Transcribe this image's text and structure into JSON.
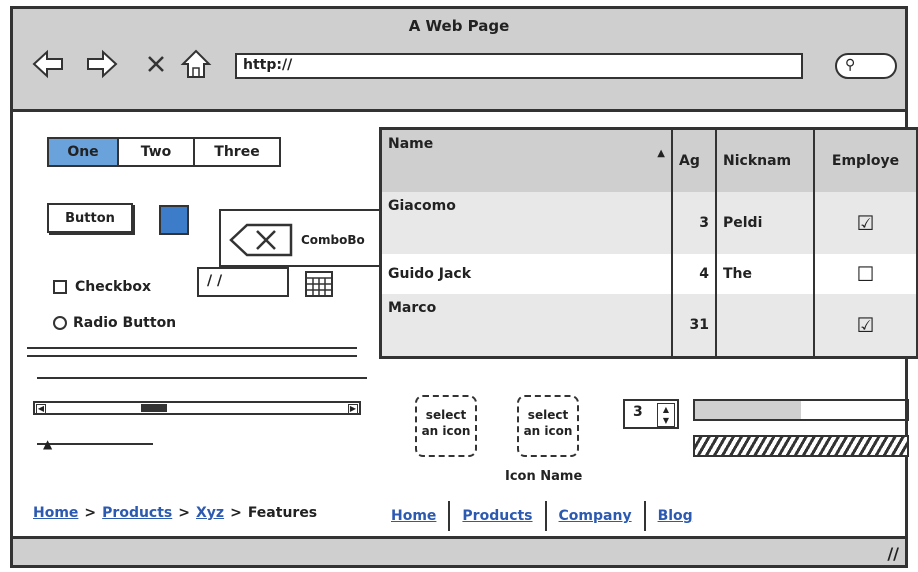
{
  "window": {
    "title": "A Web Page"
  },
  "toolbar": {
    "url": "http://",
    "search_icon": "magnifier-icon",
    "icons": [
      "back-arrow-icon",
      "forward-arrow-icon",
      "close-x-icon",
      "home-icon"
    ]
  },
  "tabs": [
    {
      "label": "One",
      "active": true
    },
    {
      "label": "Two",
      "active": false
    },
    {
      "label": "Three",
      "active": false
    }
  ],
  "controls": {
    "button_label": "Button",
    "combo_label": "ComboBo",
    "checkbox_label": "Checkbox",
    "radio_label": "Radio Button",
    "date_value": "/ /"
  },
  "grid": {
    "headers": [
      "Name",
      "Ag",
      "Nicknam",
      "Employe"
    ],
    "rows": [
      {
        "name": "Giacomo",
        "age": "3",
        "nickname": "Peldi",
        "employee": true
      },
      {
        "name": "Guido Jack",
        "age": "4",
        "nickname": "The",
        "employee": false
      },
      {
        "name": "Marco",
        "age": "31",
        "nickname": "",
        "employee": true
      }
    ]
  },
  "icon_select": {
    "label_line1": "select",
    "label_line2": "an icon",
    "icon_name": "Icon Name"
  },
  "stepper": {
    "value": "3"
  },
  "progress": {
    "value": 0.5
  },
  "breadcrumb": {
    "items": [
      "Home",
      "Products",
      "Xyz"
    ],
    "current": "Features",
    "separator": ">"
  },
  "links": [
    "Home",
    "Products",
    "Company",
    "Blog"
  ],
  "colors": {
    "accent": "#6aa3dc",
    "color_picker": "#3d7cc9",
    "chrome": "#cfcfcf",
    "link": "#2c5ab0"
  }
}
